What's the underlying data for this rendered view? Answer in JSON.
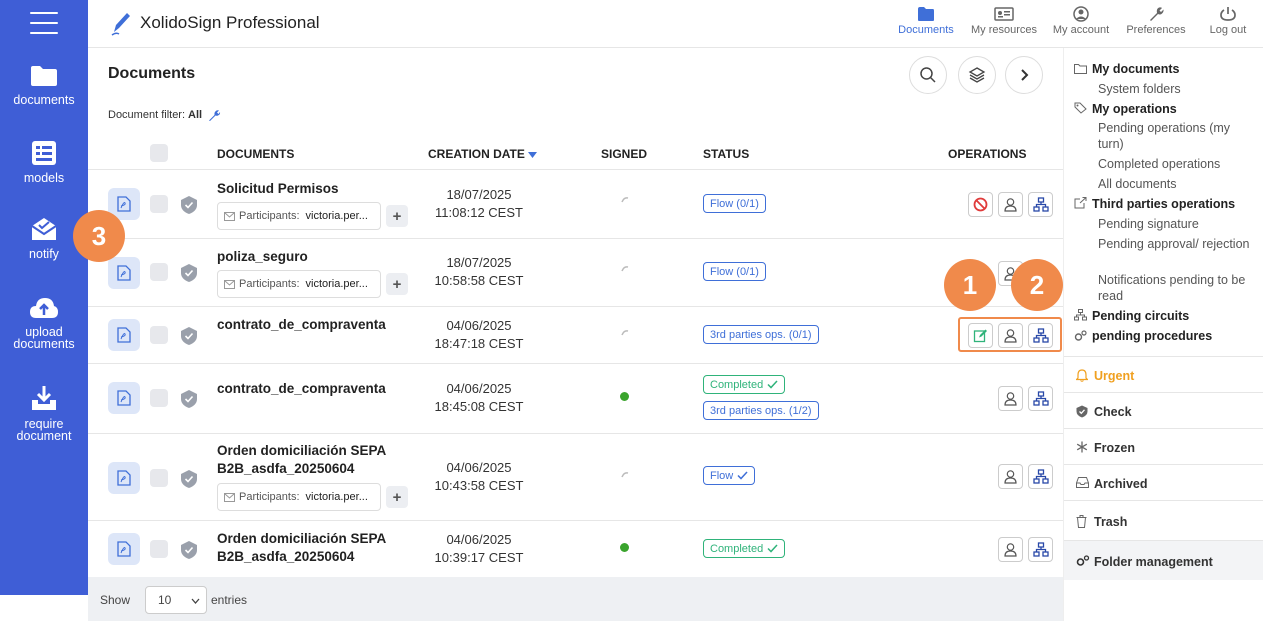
{
  "app": {
    "title": "XolidoSign Professional"
  },
  "sidebar": {
    "items": [
      {
        "label": "documents"
      },
      {
        "label": "models"
      },
      {
        "label": "notify"
      },
      {
        "label": "upload documents"
      },
      {
        "label": "require document"
      }
    ]
  },
  "topnav": [
    {
      "label": "Documents"
    },
    {
      "label": "My resources"
    },
    {
      "label": "My account"
    },
    {
      "label": "Preferences"
    },
    {
      "label": "Log out"
    }
  ],
  "main": {
    "title": "Documents",
    "filter_label": "Document filter:",
    "filter_value": "All",
    "columns": [
      "DOCUMENTS",
      "CREATION DATE",
      "SIGNED",
      "STATUS",
      "OPERATIONS"
    ],
    "participants_label": "Participants:",
    "rows": [
      {
        "name": "Solicitud Permisos",
        "participants": "victoria.per...",
        "date": "18/07/2025",
        "time": "11:08:12 CEST",
        "signed": "pending",
        "status": [
          "Flow (0/1)"
        ]
      },
      {
        "name": "poliza_seguro",
        "participants": "victoria.per...",
        "date": "18/07/2025",
        "time": "10:58:58 CEST",
        "signed": "pending",
        "status": [
          "Flow (0/1)"
        ]
      },
      {
        "name": "contrato_de_compraventa",
        "date": "04/06/2025",
        "time": "18:47:18 CEST",
        "signed": "pending",
        "status": [
          "3rd parties ops. (0/1)"
        ]
      },
      {
        "name": "contrato_de_compraventa",
        "date": "04/06/2025",
        "time": "18:45:08 CEST",
        "signed": "signed",
        "status": [
          "Completed",
          "3rd parties ops. (1/2)"
        ]
      },
      {
        "name": "Orden domiciliación SEPA B2B_asdfa_20250604",
        "participants": "victoria.per...",
        "date": "04/06/2025",
        "time": "10:43:58 CEST",
        "signed": "pending",
        "status": [
          "Flow"
        ]
      },
      {
        "name": "Orden domiciliación SEPA B2B_asdfa_20250604",
        "date": "04/06/2025",
        "time": "10:39:17 CEST",
        "signed": "signed",
        "status": [
          "Completed"
        ]
      }
    ],
    "footer": {
      "show": "Show",
      "entries_value": "10",
      "entries": "entries"
    }
  },
  "callouts": [
    "1",
    "2",
    "3"
  ],
  "right_panel": {
    "my_documents": "My documents",
    "system_folders": "System folders",
    "my_operations": "My operations",
    "pending_my_turn": "Pending operations (my turn)",
    "completed_operations": "Completed operations",
    "all_documents": "All documents",
    "third_parties": "Third parties operations",
    "pending_signature": "Pending signature",
    "pending_approval": "Pending approval/ rejection",
    "notifications_pending": "Notifications pending to be read",
    "pending_circuits": "Pending circuits",
    "pending_procedures": "pending procedures",
    "urgent": "Urgent",
    "check": "Check",
    "frozen": "Frozen",
    "archived": "Archived",
    "trash": "Trash",
    "folder_management": "Folder management"
  },
  "colors": {
    "sidebar": "#3f5ed6",
    "accent": "#3f6fd8",
    "callout": "#f08a4b",
    "success": "#2fb37a",
    "urgent": "#f0a020"
  }
}
